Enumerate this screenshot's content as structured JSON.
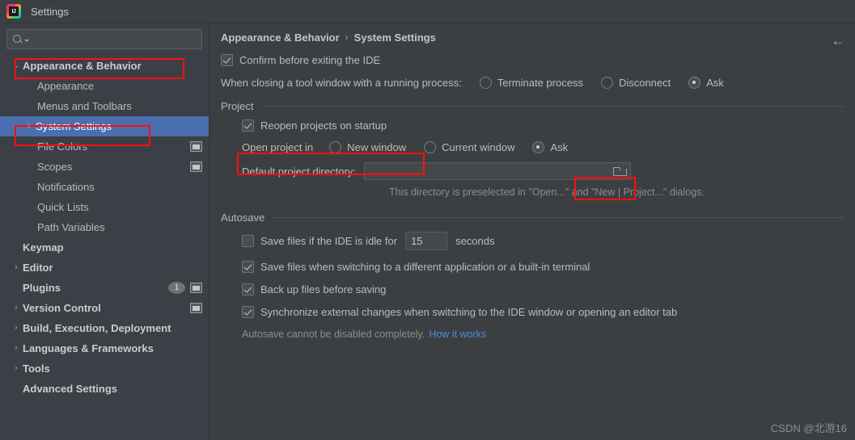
{
  "window": {
    "title": "Settings",
    "logo_icon": "intellij-idea-logo"
  },
  "sidebar": {
    "search": {
      "placeholder": "",
      "value": "",
      "icon": "search-icon"
    },
    "items": [
      {
        "label": "Appearance & Behavior",
        "level": 0,
        "chevron": "⌄",
        "bold": true,
        "selected": false,
        "icon": "",
        "badge": "",
        "highlighted": true
      },
      {
        "label": "Appearance",
        "level": 1,
        "chevron": "",
        "bold": false,
        "selected": false,
        "icon": "",
        "badge": "",
        "highlighted": false
      },
      {
        "label": "Menus and Toolbars",
        "level": 1,
        "chevron": "",
        "bold": false,
        "selected": false,
        "icon": "",
        "badge": "",
        "highlighted": false
      },
      {
        "label": "System Settings",
        "level": 1,
        "chevron": "›",
        "bold": false,
        "selected": true,
        "icon": "",
        "badge": "",
        "highlighted": true
      },
      {
        "label": "File Colors",
        "level": 1,
        "chevron": "",
        "bold": false,
        "selected": false,
        "icon": "window-icon",
        "badge": "",
        "highlighted": false
      },
      {
        "label": "Scopes",
        "level": 1,
        "chevron": "",
        "bold": false,
        "selected": false,
        "icon": "window-icon",
        "badge": "",
        "highlighted": false
      },
      {
        "label": "Notifications",
        "level": 1,
        "chevron": "",
        "bold": false,
        "selected": false,
        "icon": "",
        "badge": "",
        "highlighted": false
      },
      {
        "label": "Quick Lists",
        "level": 1,
        "chevron": "",
        "bold": false,
        "selected": false,
        "icon": "",
        "badge": "",
        "highlighted": false
      },
      {
        "label": "Path Variables",
        "level": 1,
        "chevron": "",
        "bold": false,
        "selected": false,
        "icon": "",
        "badge": "",
        "highlighted": false
      },
      {
        "label": "Keymap",
        "level": 0,
        "chevron": "",
        "bold": true,
        "selected": false,
        "icon": "",
        "badge": "",
        "highlighted": false
      },
      {
        "label": "Editor",
        "level": 0,
        "chevron": "›",
        "bold": true,
        "selected": false,
        "icon": "",
        "badge": "",
        "highlighted": false
      },
      {
        "label": "Plugins",
        "level": 0,
        "chevron": "",
        "bold": true,
        "selected": false,
        "icon": "window-icon",
        "badge": "1",
        "highlighted": false
      },
      {
        "label": "Version Control",
        "level": 0,
        "chevron": "›",
        "bold": true,
        "selected": false,
        "icon": "window-icon",
        "badge": "",
        "highlighted": false
      },
      {
        "label": "Build, Execution, Deployment",
        "level": 0,
        "chevron": "›",
        "bold": true,
        "selected": false,
        "icon": "",
        "badge": "",
        "highlighted": false
      },
      {
        "label": "Languages & Frameworks",
        "level": 0,
        "chevron": "›",
        "bold": true,
        "selected": false,
        "icon": "",
        "badge": "",
        "highlighted": false
      },
      {
        "label": "Tools",
        "level": 0,
        "chevron": "›",
        "bold": true,
        "selected": false,
        "icon": "",
        "badge": "",
        "highlighted": false
      },
      {
        "label": "Advanced Settings",
        "level": 0,
        "chevron": "",
        "bold": true,
        "selected": false,
        "icon": "",
        "badge": "",
        "highlighted": false
      }
    ]
  },
  "main": {
    "breadcrumb": {
      "parent": "Appearance & Behavior",
      "separator": "›",
      "current": "System Settings"
    },
    "back_icon": "←",
    "confirm_exit": {
      "label": "Confirm before exiting the IDE",
      "checked": true
    },
    "tool_window_close": {
      "label": "When closing a tool window with a running process:",
      "options": [
        {
          "label": "Terminate process",
          "selected": false
        },
        {
          "label": "Disconnect",
          "selected": false
        },
        {
          "label": "Ask",
          "selected": true
        }
      ]
    },
    "project_section": {
      "title": "Project",
      "reopen": {
        "label": "Reopen projects on startup",
        "checked": true
      },
      "open_project_in": {
        "label": "Open project in",
        "options": [
          {
            "label": "New window",
            "selected": false
          },
          {
            "label": "Current window",
            "selected": false
          },
          {
            "label": "Ask",
            "selected": true
          }
        ]
      },
      "default_dir": {
        "label": "Default project directory:",
        "value": "",
        "browse_icon": "folder-icon",
        "hint": "This directory is preselected in \"Open...\" and \"New | Project...\" dialogs."
      }
    },
    "autosave_section": {
      "title": "Autosave",
      "idle": {
        "label_before": "Save files if the IDE is idle for",
        "checked": false,
        "seconds_value": "15",
        "label_after": "seconds"
      },
      "options": [
        {
          "label": "Save files when switching to a different application or a built-in terminal",
          "checked": true
        },
        {
          "label": "Back up files before saving",
          "checked": true
        },
        {
          "label": "Synchronize external changes when switching to the IDE window or opening an editor tab",
          "checked": true
        }
      ],
      "footer_text": "Autosave cannot be disabled completely.",
      "footer_link": "How it works"
    }
  },
  "watermark": "CSDN @北游16",
  "colors": {
    "panel_bg": "#3c3f41",
    "sidebar_bg": "#3c3f45",
    "selection_blue": "#4b6eaf",
    "annotation_red": "#ff1010",
    "link_blue": "#4a90d9",
    "text": "#bbbbbb"
  }
}
